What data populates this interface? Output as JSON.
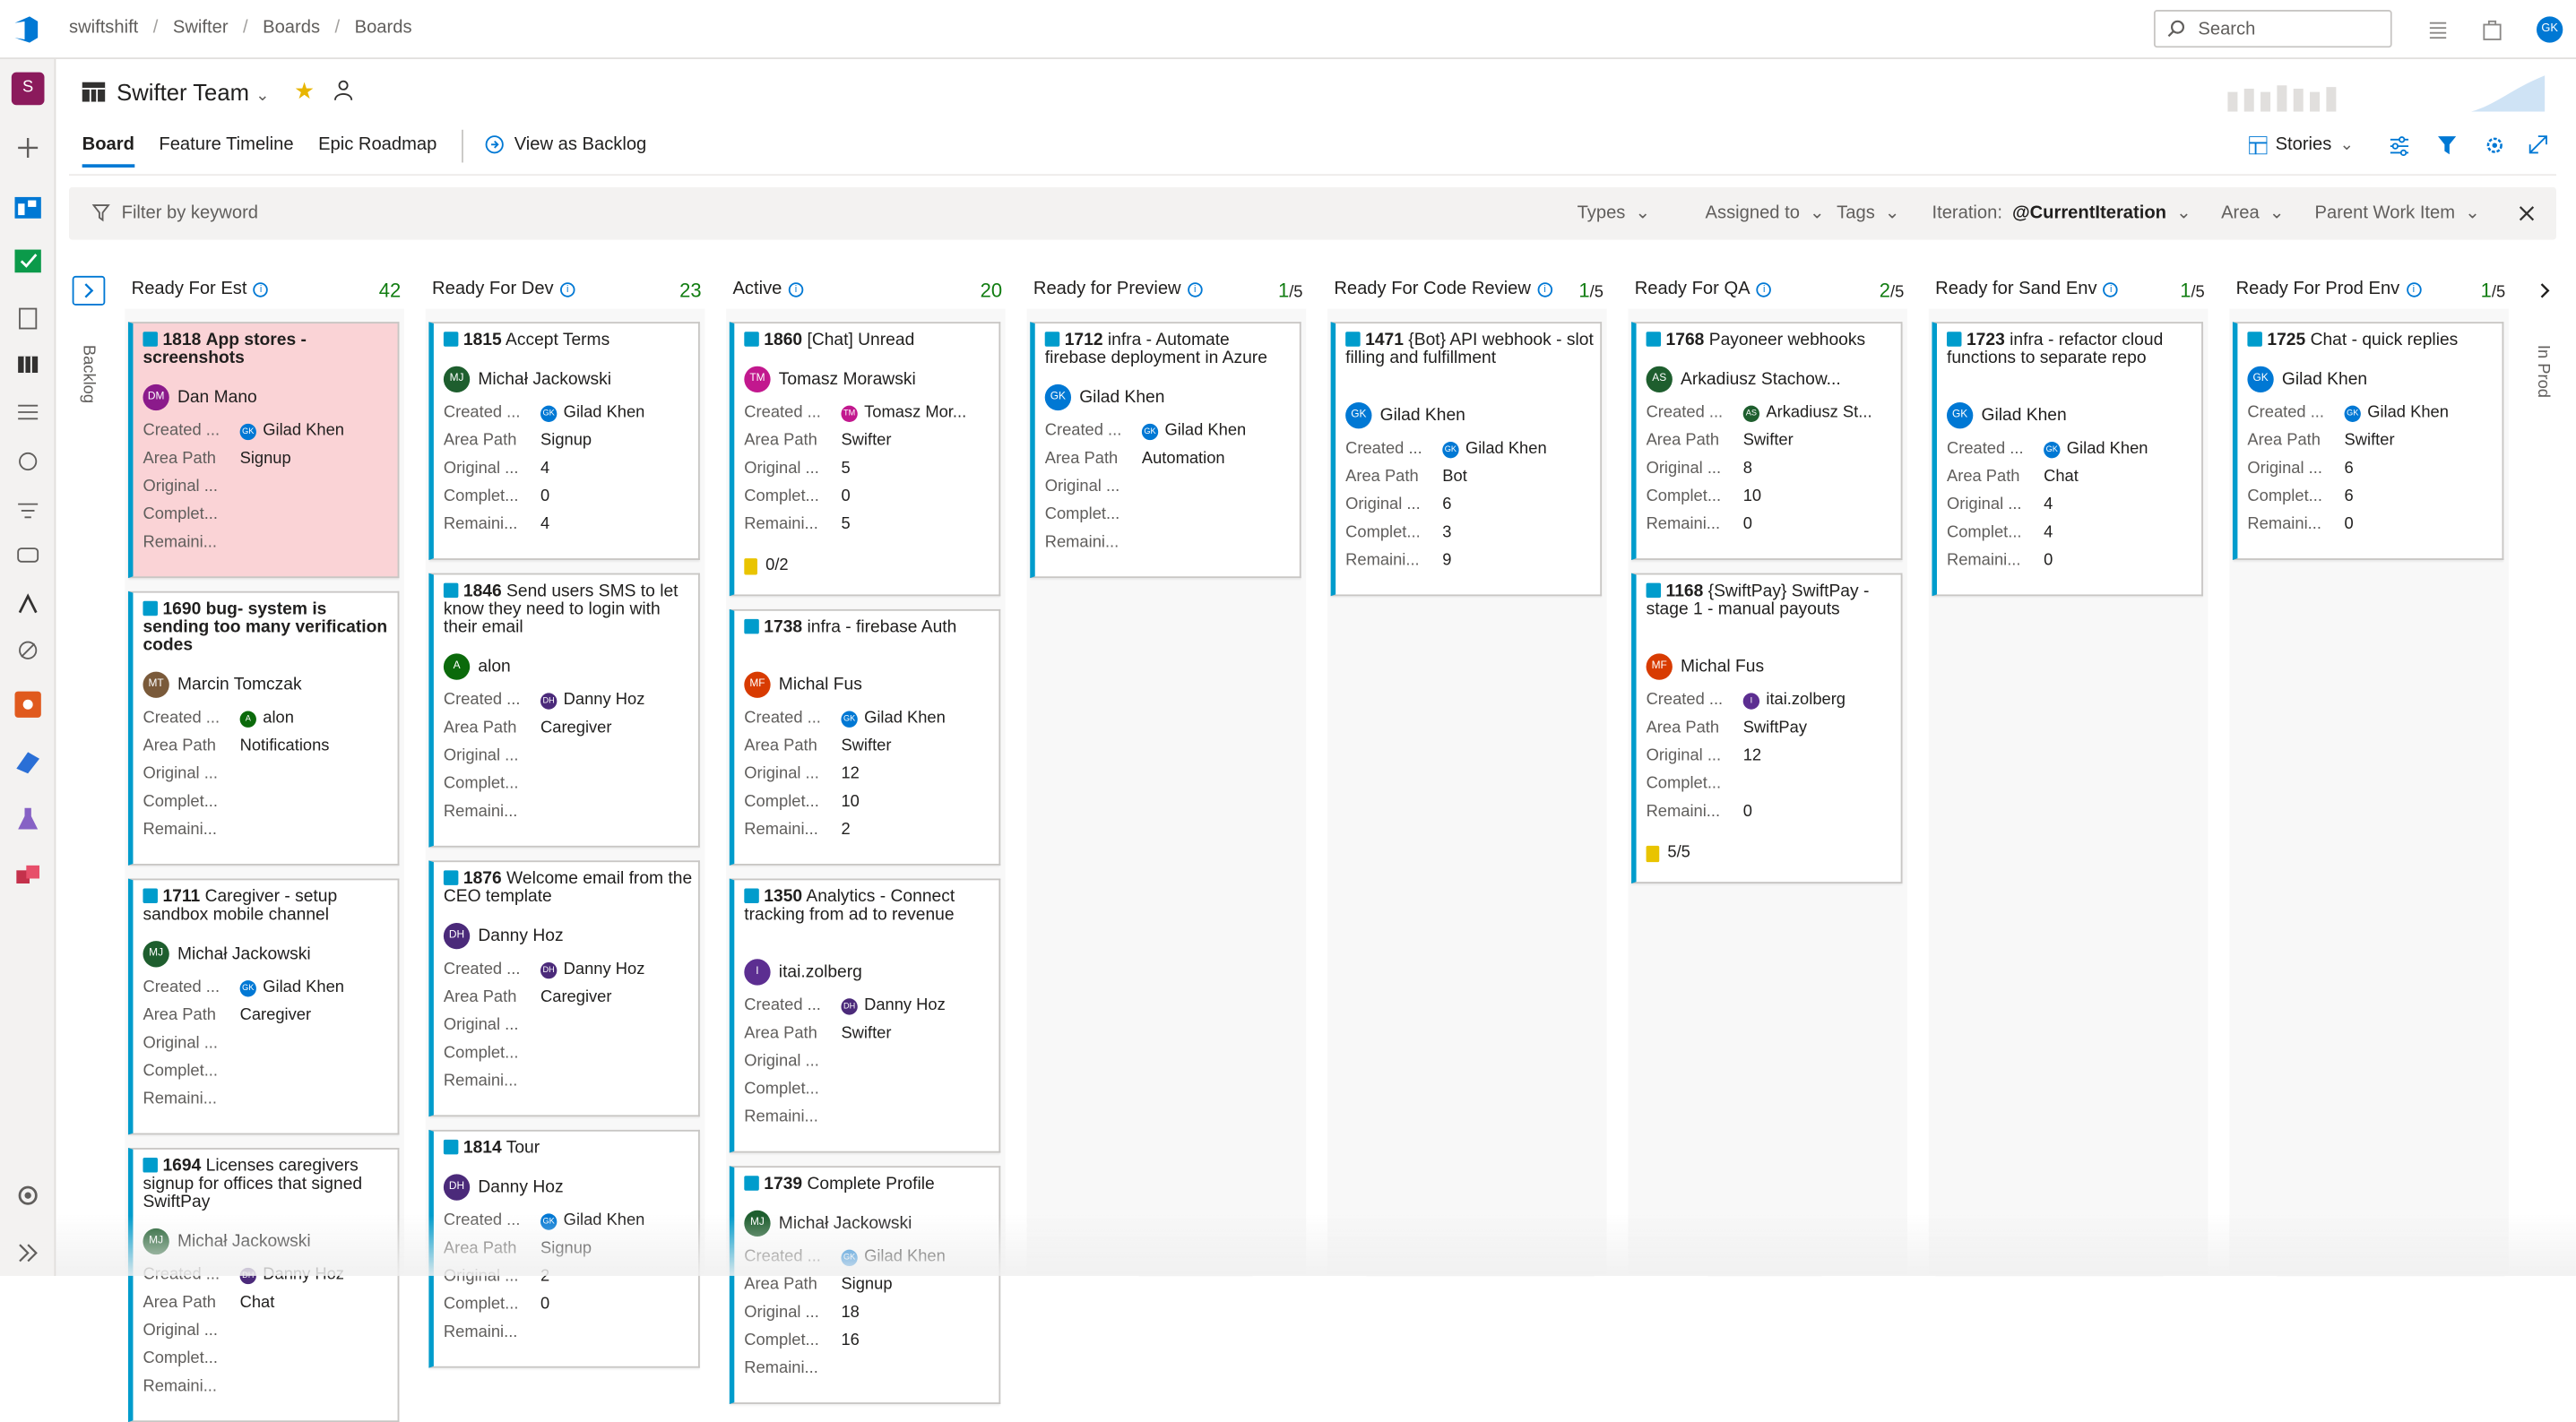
{
  "breadcrumb": {
    "org": "swiftshift",
    "project": "Swifter",
    "section": "Boards",
    "page": "Boards"
  },
  "search": {
    "placeholder": "Search"
  },
  "user_initials": "GK",
  "rail_project_initial": "S",
  "team": {
    "name": "Swifter Team"
  },
  "tabs": [
    {
      "label": "Board",
      "active": true
    },
    {
      "label": "Feature Timeline",
      "active": false
    },
    {
      "label": "Epic Roadmap",
      "active": false
    }
  ],
  "view_as_backlog": "View as Backlog",
  "backlog_level": "Stories",
  "filter": {
    "placeholder": "Filter by keyword",
    "types": "Types",
    "assigned_to": "Assigned to",
    "tags": "Tags",
    "iteration_label": "Iteration:",
    "iteration_value": "@CurrentIteration",
    "area": "Area",
    "parent_work_item": "Parent Work Item"
  },
  "side_labels": {
    "backlog": "Backlog",
    "in_prod": "In Prod"
  },
  "field_labels": {
    "created": "Created ...",
    "area_path": "Area Path",
    "original": "Original ...",
    "completed": "Complet...",
    "remaining": "Remaini..."
  },
  "colors": {
    "accent": "#0078d4",
    "story": "#009ccc",
    "pink_card": "#fad3d6",
    "count": "#107c10"
  },
  "columns": [
    {
      "name": "Ready For Est",
      "count": "42",
      "limit": "",
      "cards": [
        {
          "id": "1818",
          "title": "App stores - screenshots",
          "bold": true,
          "pink": true,
          "owner": "Dan Mano",
          "owner_initials": "DM",
          "owner_color": "#8b1a8b",
          "created_by": "Gilad Khen",
          "created_initials": "GK",
          "created_color": "#0078d4",
          "area": "Signup",
          "original": "",
          "completed": "",
          "remaining": "",
          "tasks": ""
        },
        {
          "id": "1690",
          "title": "bug- system is sending too many verification codes",
          "bold": true,
          "owner": "Marcin Tomczak",
          "owner_initials": "MT",
          "owner_color": "#7a5a3a",
          "created_by": "alon",
          "created_initials": "A",
          "created_color": "#0b6a0b",
          "area": "Notifications",
          "original": "",
          "completed": "",
          "remaining": "",
          "tasks": ""
        },
        {
          "id": "1711",
          "title": "Caregiver - setup sandbox mobile channel",
          "owner": "Michał Jackowski",
          "owner_initials": "MJ",
          "owner_color": "#1e5e2e",
          "created_by": "Gilad Khen",
          "created_initials": "GK",
          "created_color": "#0078d4",
          "area": "Caregiver",
          "original": "",
          "completed": "",
          "remaining": "",
          "tasks": ""
        },
        {
          "id": "1694",
          "title": "Licenses caregivers signup for offices that signed SwiftPay",
          "owner": "Michał Jackowski",
          "owner_initials": "MJ",
          "owner_color": "#1e5e2e",
          "created_by": "Danny Hoz",
          "created_initials": "DH",
          "created_color": "#4b2a7a",
          "area": "Chat",
          "original": "",
          "completed": "",
          "remaining": "",
          "tasks": ""
        }
      ]
    },
    {
      "name": "Ready For Dev",
      "count": "23",
      "limit": "",
      "cards": [
        {
          "id": "1815",
          "title": "Accept Terms",
          "owner": "Michał Jackowski",
          "owner_initials": "MJ",
          "owner_color": "#1e5e2e",
          "created_by": "Gilad Khen",
          "created_initials": "GK",
          "created_color": "#0078d4",
          "area": "Signup",
          "original": "4",
          "completed": "0",
          "remaining": "4",
          "tasks": ""
        },
        {
          "id": "1846",
          "title": "Send users SMS to let know they need to login with their email",
          "owner": "alon",
          "owner_initials": "A",
          "owner_color": "#0b6a0b",
          "created_by": "Danny Hoz",
          "created_initials": "DH",
          "created_color": "#4b2a7a",
          "area": "Caregiver",
          "original": "",
          "completed": "",
          "remaining": "",
          "tasks": ""
        },
        {
          "id": "1876",
          "title": "Welcome email from the CEO template",
          "owner": "Danny Hoz",
          "owner_initials": "DH",
          "owner_color": "#4b2a7a",
          "created_by": "Danny Hoz",
          "created_initials": "DH",
          "created_color": "#4b2a7a",
          "area": "Caregiver",
          "original": "",
          "completed": "",
          "remaining": "",
          "tasks": ""
        },
        {
          "id": "1814",
          "title": "Tour",
          "owner": "Danny Hoz",
          "owner_initials": "DH",
          "owner_color": "#4b2a7a",
          "created_by": "Gilad Khen",
          "created_initials": "GK",
          "created_color": "#0078d4",
          "area": "Signup",
          "original": "2",
          "completed": "0",
          "remaining": "",
          "tasks": ""
        }
      ]
    },
    {
      "name": "Active",
      "count": "20",
      "limit": "",
      "cards": [
        {
          "id": "1860",
          "title": "[Chat] Unread",
          "owner": "Tomasz Morawski",
          "owner_initials": "TM",
          "owner_color": "#c2188e",
          "created_by": "Tomasz Mor...",
          "created_initials": "TM",
          "created_color": "#c2188e",
          "area": "Swifter",
          "original": "5",
          "completed": "0",
          "remaining": "5",
          "tasks": "0/2"
        },
        {
          "id": "1738",
          "title": "infra - firebase Auth",
          "owner": "Michal Fus",
          "owner_initials": "MF",
          "owner_color": "#d83b01",
          "created_by": "Gilad Khen",
          "created_initials": "GK",
          "created_color": "#0078d4",
          "area": "Swifter",
          "original": "12",
          "completed": "10",
          "remaining": "2",
          "tasks": ""
        },
        {
          "id": "1350",
          "title": "Analytics - Connect tracking from ad to revenue",
          "owner": "itai.zolberg",
          "owner_initials": "I",
          "owner_color": "#5c2e91",
          "created_by": "Danny Hoz",
          "created_initials": "DH",
          "created_color": "#4b2a7a",
          "area": "Swifter",
          "original": "",
          "completed": "",
          "remaining": "",
          "tasks": ""
        },
        {
          "id": "1739",
          "title": "Complete Profile",
          "owner": "Michał Jackowski",
          "owner_initials": "MJ",
          "owner_color": "#1e5e2e",
          "created_by": "Gilad Khen",
          "created_initials": "GK",
          "created_color": "#0078d4",
          "area": "Signup",
          "original": "18",
          "completed": "16",
          "remaining": "",
          "tasks": ""
        }
      ]
    },
    {
      "name": "Ready for Preview",
      "count": "1",
      "limit": "/5",
      "cards": [
        {
          "id": "1712",
          "title": "infra - Automate firebase deployment in Azure",
          "owner": "Gilad Khen",
          "owner_initials": "GK",
          "owner_color": "#0078d4",
          "created_by": "Gilad Khen",
          "created_initials": "GK",
          "created_color": "#0078d4",
          "area": "Automation",
          "original": "",
          "completed": "",
          "remaining": "",
          "tasks": ""
        }
      ]
    },
    {
      "name": "Ready For Code Review",
      "count": "1",
      "limit": "/5",
      "cards": [
        {
          "id": "1471",
          "title": "{Bot} API webhook - slot filling and fulfillment",
          "owner": "Gilad Khen",
          "owner_initials": "GK",
          "owner_color": "#0078d4",
          "created_by": "Gilad Khen",
          "created_initials": "GK",
          "created_color": "#0078d4",
          "area": "Bot",
          "original": "6",
          "completed": "3",
          "remaining": "9",
          "tasks": ""
        }
      ]
    },
    {
      "name": "Ready For QA",
      "count": "2",
      "limit": "/5",
      "cards": [
        {
          "id": "1768",
          "title": "Payoneer webhooks",
          "owner": "Arkadiusz Stachow...",
          "owner_initials": "AS",
          "owner_color": "#1e5e2e",
          "created_by": "Arkadiusz St...",
          "created_initials": "AS",
          "created_color": "#1e5e2e",
          "area": "Swifter",
          "original": "8",
          "completed": "10",
          "remaining": "0",
          "tasks": ""
        },
        {
          "id": "1168",
          "title": "{SwiftPay} SwiftPay - stage 1 - manual payouts",
          "owner": "Michal Fus",
          "owner_initials": "MF",
          "owner_color": "#d83b01",
          "created_by": "itai.zolberg",
          "created_initials": "I",
          "created_color": "#5c2e91",
          "area": "SwiftPay",
          "original": "12",
          "completed": "",
          "remaining": "0",
          "tasks": "5/5"
        }
      ]
    },
    {
      "name": "Ready for Sand Env",
      "count": "1",
      "limit": "/5",
      "cards": [
        {
          "id": "1723",
          "title": "infra - refactor cloud functions to separate repo",
          "owner": "Gilad Khen",
          "owner_initials": "GK",
          "owner_color": "#0078d4",
          "created_by": "Gilad Khen",
          "created_initials": "GK",
          "created_color": "#0078d4",
          "area": "Chat",
          "original": "4",
          "completed": "4",
          "remaining": "0",
          "tasks": ""
        }
      ]
    },
    {
      "name": "Ready For Prod Env",
      "count": "1",
      "limit": "/5",
      "cards": [
        {
          "id": "1725",
          "title": "Chat - quick replies",
          "owner": "Gilad Khen",
          "owner_initials": "GK",
          "owner_color": "#0078d4",
          "created_by": "Gilad Khen",
          "created_initials": "GK",
          "created_color": "#0078d4",
          "area": "Swifter",
          "original": "6",
          "completed": "6",
          "remaining": "0",
          "tasks": ""
        }
      ]
    }
  ]
}
